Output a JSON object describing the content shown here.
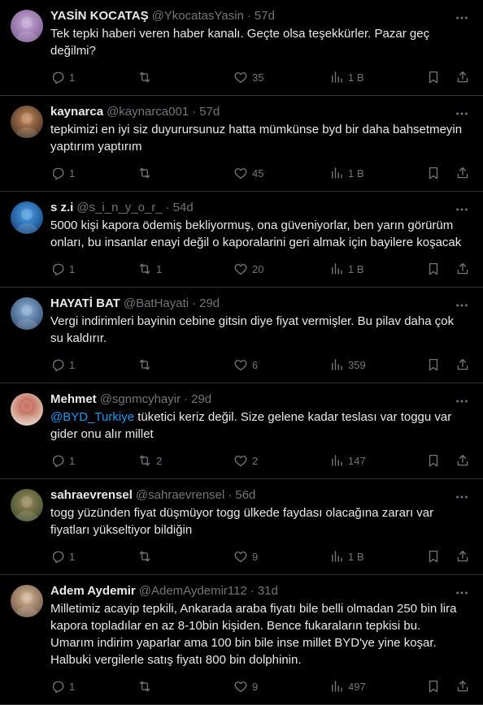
{
  "feed": {
    "tweets": [
      {
        "name": "YASİN KOCATAŞ",
        "handle": "@YkocatasYasin",
        "sep": "·",
        "time": "57d",
        "text": "Tek tepki haberi veren haber kanalı. Geçte olsa teşekkürler. Pazar geç değilmi?",
        "replies": "1",
        "retweets": "",
        "likes": "35",
        "views": "1 B",
        "avatar_colors": [
          "#c8a7d8",
          "#7a5a8f"
        ]
      },
      {
        "name": "kaynarca",
        "handle": "@kaynarca001",
        "sep": "·",
        "time": "57d",
        "text": "tepkimizi en iyi siz duyurursunuz hatta mümkünse byd bir daha bahsetmeyin yaptırım yaptırım",
        "replies": "1",
        "retweets": "",
        "likes": "45",
        "views": "1 B",
        "avatar_colors": [
          "#c98a5a",
          "#3a2a20"
        ]
      },
      {
        "name": "s z.i",
        "handle": "@s_i_n_y_o_r_",
        "sep": "·",
        "time": "54d",
        "text": "5000 kişi kapora ödemiş bekliyormuş, ona güveniyorlar, ben yarın görürüm onları, bu insanlar enayi değil o kaporalarini geri almak için bayilere koşacak",
        "replies": "1",
        "retweets": "1",
        "likes": "20",
        "views": "1 B",
        "avatar_colors": [
          "#4fa3e8",
          "#0d3d7a"
        ]
      },
      {
        "name": "HAYATİ BAT",
        "handle": "@BatHayati",
        "sep": "·",
        "time": "29d",
        "text": "Vergi indirimleri bayinin cebine gitsin diye fiyat vermişler. Bu pilav daha çok su kaldırır.",
        "replies": "1",
        "retweets": "",
        "likes": "6",
        "views": "359",
        "avatar_colors": [
          "#8fb0d8",
          "#2d4a6e"
        ]
      },
      {
        "name": "Mehmet",
        "handle": "@sgnmcyhayir",
        "sep": "·",
        "time": "29d",
        "mention": "@BYD_Turkiye",
        "text": " tüketici keriz değil. Size gelene kadar teslası var toggu var gider onu alır millet",
        "replies": "1",
        "retweets": "2",
        "likes": "2",
        "views": "147",
        "avatar_colors": [
          "#b94a3a",
          "#e8e0d0"
        ]
      },
      {
        "name": "sahraevrensel",
        "handle": "@sahraevrensel",
        "sep": "·",
        "time": "56d",
        "text": "togg yüzünden fiyat düşmüyor togg ülkede faydası olacağına zararı var fiyatları yükseltiyor bildiğin",
        "replies": "1",
        "retweets": "",
        "likes": "9",
        "views": "1 B",
        "avatar_colors": [
          "#9a8a5a",
          "#3a4a2a"
        ]
      },
      {
        "name": "Adem Aydemir",
        "handle": "@AdemAydemir112",
        "sep": "·",
        "time": "31d",
        "text": "Milletimiz acayip tepkili, Ankarada araba fiyatı bile belli olmadan 250 bin lira kapora topladılar en az 8-10bin kişiden. Bence fukaraların tepkisi bu. Umarım indirim yaparlar ama 100 bin bile inse millet BYD'ye yine koşar. Halbuki vergilerle satış fiyatı 800 bin dolphinin.",
        "replies": "1",
        "retweets": "",
        "likes": "9",
        "views": "497",
        "avatar_colors": [
          "#d8b898",
          "#6a5040"
        ]
      }
    ]
  },
  "icons": {
    "reply": "reply-icon",
    "retweet": "retweet-icon",
    "like": "heart-icon",
    "views": "analytics-icon",
    "bookmark": "bookmark-icon",
    "share": "share-icon",
    "more": "more-icon"
  },
  "colors": {
    "background": "#000000",
    "text": "#e7e9ea",
    "muted": "#71767b",
    "border": "#2f3336",
    "link": "#1d9bf0"
  }
}
